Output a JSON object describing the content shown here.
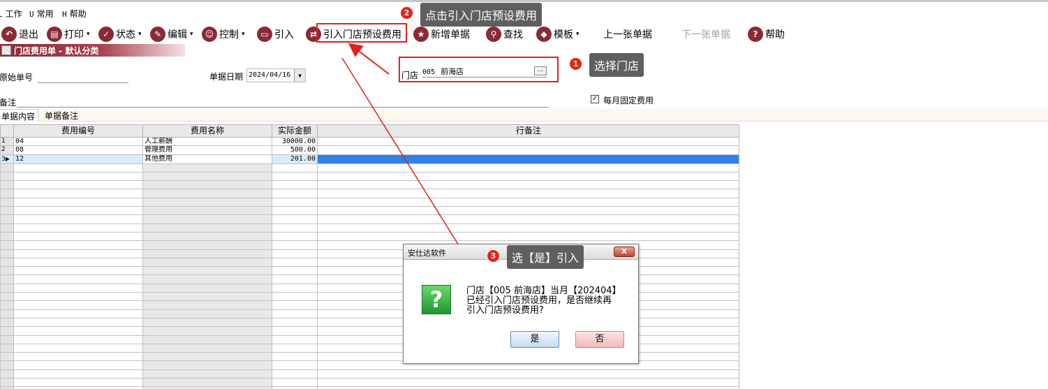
{
  "menu": {
    "items": [
      {
        "acc": "L",
        "label": "工作"
      },
      {
        "acc": "U",
        "label": "常用"
      },
      {
        "acc": "H",
        "label": "帮助"
      }
    ]
  },
  "toolbar": {
    "exit": "退出",
    "print": "打印",
    "status": "状态",
    "edit": "编辑",
    "control": "控制",
    "import": "引入",
    "import_store_preset": "引入门店预设费用",
    "new_doc": "新增单据",
    "find": "查找",
    "template": "模板",
    "prev_doc": "上一张单据",
    "next_doc": "下一张单据",
    "help": "帮助"
  },
  "doc_title": "门店费用单 - 默认分类",
  "form": {
    "original_no_label": "原始单号",
    "original_no_value": "",
    "date_label": "单据日期",
    "date_value": "2024/04/16",
    "store_label": "门店",
    "store_code": "005",
    "store_name": "前海店",
    "store_more": "…",
    "remark_label": "备注",
    "remark_value": "",
    "monthly_fixed_label": "每月固定费用",
    "monthly_fixed_checked": "✓"
  },
  "tabs": [
    "单据内容",
    "单据备注"
  ],
  "grid": {
    "headers": {
      "code": "费用编号",
      "name": "费用名称",
      "amount": "实际金额",
      "note": "行备注"
    },
    "rows": [
      {
        "rn": "1",
        "code": "04",
        "name": "人工薪酬",
        "amount": "30000.00",
        "note": ""
      },
      {
        "rn": "2",
        "code": "08",
        "name": "管理费用",
        "amount": "500.00",
        "note": ""
      },
      {
        "rn": "3",
        "code": "12",
        "name": "其他费用",
        "amount": "201.00",
        "note": ""
      }
    ]
  },
  "callouts": {
    "step1": {
      "num": "1",
      "text": "选择门店"
    },
    "step2": {
      "num": "2",
      "text": "点击引入门店预设费用"
    },
    "step3": {
      "num": "3",
      "text": "选【是】引入"
    }
  },
  "dialog": {
    "title": "安仕达软件",
    "close": "X",
    "icon": "?",
    "line1": "门店【005 前海店】当月【202404】",
    "line2": "已经引入门店预设费用，是否继续再",
    "line3": "引入门店预设费用?",
    "yes": "是",
    "no": "否"
  },
  "colors": {
    "accent": "#8a2a35",
    "highlight": "#e2201a",
    "selection": "#2e82e8"
  }
}
